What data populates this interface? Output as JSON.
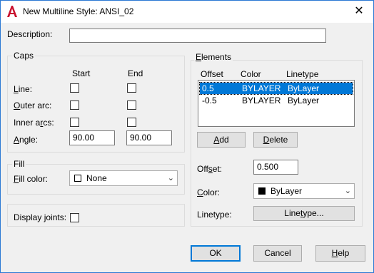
{
  "window": {
    "title": "New Multiline Style: ANSI_02",
    "close_glyph": "✕"
  },
  "description": {
    "label": "Description:",
    "value": ""
  },
  "caps": {
    "title": "Caps",
    "start_header": "Start",
    "end_header": "End",
    "rows": [
      {
        "label": "Line:",
        "start_checked": false,
        "end_checked": false
      },
      {
        "label": "Outer arc:",
        "start_checked": false,
        "end_checked": false
      },
      {
        "label": "Inner arcs:",
        "start_checked": false,
        "end_checked": false
      }
    ],
    "angle": {
      "label": "Angle:",
      "start_value": "90.00",
      "end_value": "90.00"
    }
  },
  "fill": {
    "title": "Fill",
    "color_label": "Fill color:",
    "color_value": "None",
    "swatch_color": "#ffffff"
  },
  "display_joints": {
    "label": "Display joints:",
    "checked": false
  },
  "elements": {
    "title": "Elements",
    "columns": [
      "Offset",
      "Color",
      "Linetype"
    ],
    "rows": [
      {
        "offset": "0.5",
        "color": "BYLAYER",
        "linetype": "ByLayer",
        "selected": true
      },
      {
        "offset": "-0.5",
        "color": "BYLAYER",
        "linetype": "ByLayer",
        "selected": false
      }
    ],
    "add_label": "Add",
    "delete_label": "Delete",
    "offset_label": "Offset:",
    "offset_value": "0.500",
    "color_label": "Color:",
    "color_value": "ByLayer",
    "color_swatch": "#000000",
    "linetype_label": "Linetype:",
    "linetype_button": "Linetype..."
  },
  "footer": {
    "ok": "OK",
    "cancel": "Cancel",
    "help": "Help"
  },
  "colors": {
    "accent": "#0078d7",
    "app_icon": "#c8102e"
  }
}
